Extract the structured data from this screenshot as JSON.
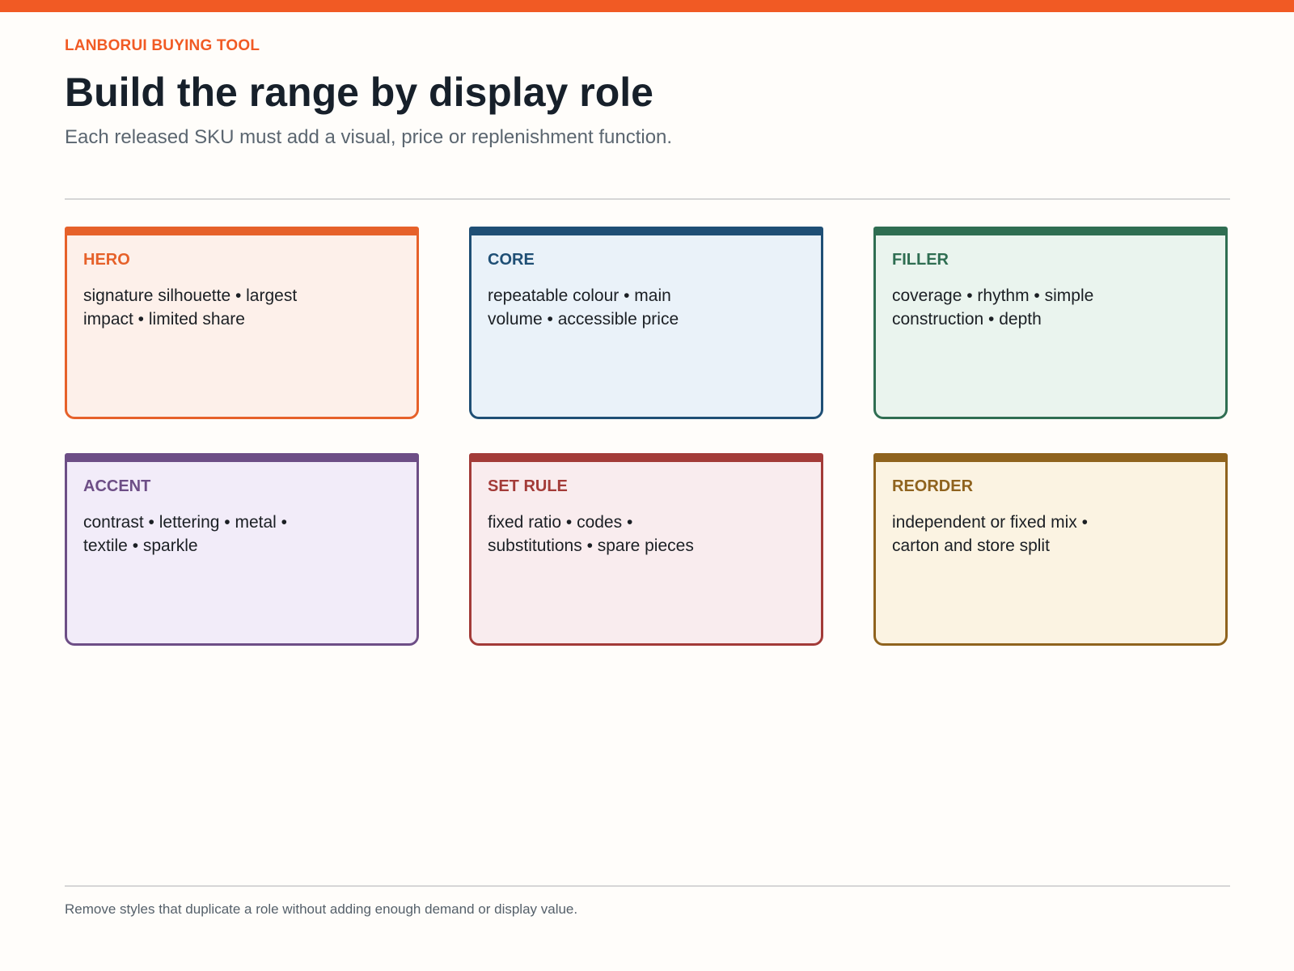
{
  "header": {
    "eyebrow": "LANBORUI BUYING TOOL",
    "title": "Build the range by display role",
    "subtitle": "Each released SKU must add a visual, price or replenishment function."
  },
  "colors": {
    "accent": "#f15a24",
    "text_dark": "#17202a",
    "text_muted": "#5b6670",
    "divider": "#d6d6d6",
    "background": "#fffdfa"
  },
  "cards": [
    {
      "title": "HERO",
      "text": "signature silhouette • largest impact • limited share",
      "color": "#e6612a",
      "bg": "#fdf0ea"
    },
    {
      "title": "CORE",
      "text": "repeatable colour • main volume • accessible price",
      "color": "#1f4f75",
      "bg": "#eaf2f9"
    },
    {
      "title": "FILLER",
      "text": "coverage • rhythm • simple construction • depth",
      "color": "#2f6e52",
      "bg": "#eaf4ee"
    },
    {
      "title": "ACCENT",
      "text": "contrast • lettering • metal • textile • sparkle",
      "color": "#6d4e86",
      "bg": "#f2ecf9"
    },
    {
      "title": "SET RULE",
      "text": "fixed ratio • codes • substitutions • spare pieces",
      "color": "#a33b38",
      "bg": "#f9ecee"
    },
    {
      "title": "REORDER",
      "text": "independent or fixed mix • carton and store split",
      "color": "#8f631e",
      "bg": "#fbf3e2"
    }
  ],
  "footer": {
    "note": "Remove styles that duplicate a role without adding enough demand or display value."
  }
}
